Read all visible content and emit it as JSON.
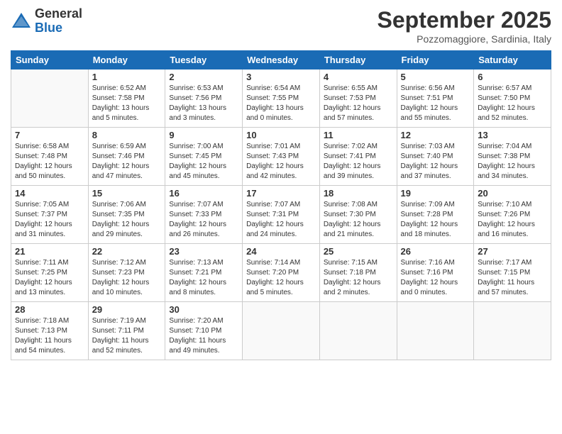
{
  "logo": {
    "general": "General",
    "blue": "Blue"
  },
  "title": "September 2025",
  "location": "Pozzomaggiore, Sardinia, Italy",
  "weekdays": [
    "Sunday",
    "Monday",
    "Tuesday",
    "Wednesday",
    "Thursday",
    "Friday",
    "Saturday"
  ],
  "weeks": [
    [
      {
        "day": "",
        "sunrise": "",
        "sunset": "",
        "daylight": ""
      },
      {
        "day": "1",
        "sunrise": "Sunrise: 6:52 AM",
        "sunset": "Sunset: 7:58 PM",
        "daylight": "Daylight: 13 hours and 5 minutes."
      },
      {
        "day": "2",
        "sunrise": "Sunrise: 6:53 AM",
        "sunset": "Sunset: 7:56 PM",
        "daylight": "Daylight: 13 hours and 3 minutes."
      },
      {
        "day": "3",
        "sunrise": "Sunrise: 6:54 AM",
        "sunset": "Sunset: 7:55 PM",
        "daylight": "Daylight: 13 hours and 0 minutes."
      },
      {
        "day": "4",
        "sunrise": "Sunrise: 6:55 AM",
        "sunset": "Sunset: 7:53 PM",
        "daylight": "Daylight: 12 hours and 57 minutes."
      },
      {
        "day": "5",
        "sunrise": "Sunrise: 6:56 AM",
        "sunset": "Sunset: 7:51 PM",
        "daylight": "Daylight: 12 hours and 55 minutes."
      },
      {
        "day": "6",
        "sunrise": "Sunrise: 6:57 AM",
        "sunset": "Sunset: 7:50 PM",
        "daylight": "Daylight: 12 hours and 52 minutes."
      }
    ],
    [
      {
        "day": "7",
        "sunrise": "Sunrise: 6:58 AM",
        "sunset": "Sunset: 7:48 PM",
        "daylight": "Daylight: 12 hours and 50 minutes."
      },
      {
        "day": "8",
        "sunrise": "Sunrise: 6:59 AM",
        "sunset": "Sunset: 7:46 PM",
        "daylight": "Daylight: 12 hours and 47 minutes."
      },
      {
        "day": "9",
        "sunrise": "Sunrise: 7:00 AM",
        "sunset": "Sunset: 7:45 PM",
        "daylight": "Daylight: 12 hours and 45 minutes."
      },
      {
        "day": "10",
        "sunrise": "Sunrise: 7:01 AM",
        "sunset": "Sunset: 7:43 PM",
        "daylight": "Daylight: 12 hours and 42 minutes."
      },
      {
        "day": "11",
        "sunrise": "Sunrise: 7:02 AM",
        "sunset": "Sunset: 7:41 PM",
        "daylight": "Daylight: 12 hours and 39 minutes."
      },
      {
        "day": "12",
        "sunrise": "Sunrise: 7:03 AM",
        "sunset": "Sunset: 7:40 PM",
        "daylight": "Daylight: 12 hours and 37 minutes."
      },
      {
        "day": "13",
        "sunrise": "Sunrise: 7:04 AM",
        "sunset": "Sunset: 7:38 PM",
        "daylight": "Daylight: 12 hours and 34 minutes."
      }
    ],
    [
      {
        "day": "14",
        "sunrise": "Sunrise: 7:05 AM",
        "sunset": "Sunset: 7:37 PM",
        "daylight": "Daylight: 12 hours and 31 minutes."
      },
      {
        "day": "15",
        "sunrise": "Sunrise: 7:06 AM",
        "sunset": "Sunset: 7:35 PM",
        "daylight": "Daylight: 12 hours and 29 minutes."
      },
      {
        "day": "16",
        "sunrise": "Sunrise: 7:07 AM",
        "sunset": "Sunset: 7:33 PM",
        "daylight": "Daylight: 12 hours and 26 minutes."
      },
      {
        "day": "17",
        "sunrise": "Sunrise: 7:07 AM",
        "sunset": "Sunset: 7:31 PM",
        "daylight": "Daylight: 12 hours and 24 minutes."
      },
      {
        "day": "18",
        "sunrise": "Sunrise: 7:08 AM",
        "sunset": "Sunset: 7:30 PM",
        "daylight": "Daylight: 12 hours and 21 minutes."
      },
      {
        "day": "19",
        "sunrise": "Sunrise: 7:09 AM",
        "sunset": "Sunset: 7:28 PM",
        "daylight": "Daylight: 12 hours and 18 minutes."
      },
      {
        "day": "20",
        "sunrise": "Sunrise: 7:10 AM",
        "sunset": "Sunset: 7:26 PM",
        "daylight": "Daylight: 12 hours and 16 minutes."
      }
    ],
    [
      {
        "day": "21",
        "sunrise": "Sunrise: 7:11 AM",
        "sunset": "Sunset: 7:25 PM",
        "daylight": "Daylight: 12 hours and 13 minutes."
      },
      {
        "day": "22",
        "sunrise": "Sunrise: 7:12 AM",
        "sunset": "Sunset: 7:23 PM",
        "daylight": "Daylight: 12 hours and 10 minutes."
      },
      {
        "day": "23",
        "sunrise": "Sunrise: 7:13 AM",
        "sunset": "Sunset: 7:21 PM",
        "daylight": "Daylight: 12 hours and 8 minutes."
      },
      {
        "day": "24",
        "sunrise": "Sunrise: 7:14 AM",
        "sunset": "Sunset: 7:20 PM",
        "daylight": "Daylight: 12 hours and 5 minutes."
      },
      {
        "day": "25",
        "sunrise": "Sunrise: 7:15 AM",
        "sunset": "Sunset: 7:18 PM",
        "daylight": "Daylight: 12 hours and 2 minutes."
      },
      {
        "day": "26",
        "sunrise": "Sunrise: 7:16 AM",
        "sunset": "Sunset: 7:16 PM",
        "daylight": "Daylight: 12 hours and 0 minutes."
      },
      {
        "day": "27",
        "sunrise": "Sunrise: 7:17 AM",
        "sunset": "Sunset: 7:15 PM",
        "daylight": "Daylight: 11 hours and 57 minutes."
      }
    ],
    [
      {
        "day": "28",
        "sunrise": "Sunrise: 7:18 AM",
        "sunset": "Sunset: 7:13 PM",
        "daylight": "Daylight: 11 hours and 54 minutes."
      },
      {
        "day": "29",
        "sunrise": "Sunrise: 7:19 AM",
        "sunset": "Sunset: 7:11 PM",
        "daylight": "Daylight: 11 hours and 52 minutes."
      },
      {
        "day": "30",
        "sunrise": "Sunrise: 7:20 AM",
        "sunset": "Sunset: 7:10 PM",
        "daylight": "Daylight: 11 hours and 49 minutes."
      },
      {
        "day": "",
        "sunrise": "",
        "sunset": "",
        "daylight": ""
      },
      {
        "day": "",
        "sunrise": "",
        "sunset": "",
        "daylight": ""
      },
      {
        "day": "",
        "sunrise": "",
        "sunset": "",
        "daylight": ""
      },
      {
        "day": "",
        "sunrise": "",
        "sunset": "",
        "daylight": ""
      }
    ]
  ]
}
